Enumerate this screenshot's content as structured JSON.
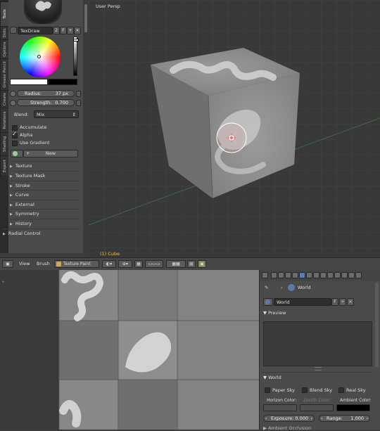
{
  "tool_tabs": [
    "Tools",
    "Slots",
    "Options",
    "Grease Pencil",
    "Create",
    "Relations",
    "Shading",
    "Export"
  ],
  "brush": {
    "name": "TexDraw",
    "users": "2",
    "fake_user": "F",
    "radius_label": "Radius:",
    "radius_value": "37 px",
    "strength_label": "Strength:",
    "strength_value": "0.700",
    "blend_label": "Blend:",
    "blend_value": "Mix",
    "accumulate_label": "Accumulate",
    "alpha_label": "Alpha",
    "use_gradient_label": "Use Gradient",
    "new_button": "New"
  },
  "checkboxes": {
    "accumulate": false,
    "alpha": true,
    "use_gradient": false
  },
  "sections": [
    "Texture",
    "Texture Mask",
    "Stroke",
    "Curve",
    "External",
    "Symmetry",
    "History"
  ],
  "radial_control": "Radial Control",
  "viewport": {
    "view_name": "User Persp",
    "object_label": "(1) Cube"
  },
  "header": {
    "view_menu": "View",
    "brush_menu": "Brush",
    "mode_label": "Texture Paint"
  },
  "properties": {
    "context": "World",
    "world_name": "World",
    "world_fake": "F",
    "preview_section": "Preview",
    "world_section": "World",
    "paper_sky": "Paper Sky",
    "blend_sky": "Blend Sky",
    "real_sky": "Real Sky",
    "horizon_color": "Horizon Color:",
    "zenith_color": "Zenith Color:",
    "ambient_color": "Ambient Color:",
    "exposure_label": "Exposure:",
    "exposure_value": "0.000",
    "range_label": "Range:",
    "range_value": "1.000",
    "ambient_occlusion": "Ambient Occlusion"
  },
  "colors": {
    "horizon": "#505050",
    "zenith": "#505050",
    "ambient": "#000000",
    "selected_color": "#ffffff"
  }
}
